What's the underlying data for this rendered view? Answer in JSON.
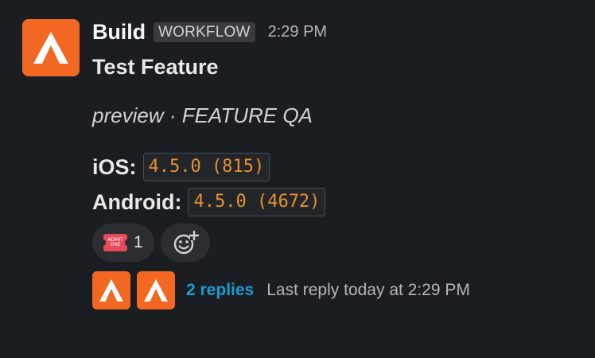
{
  "message": {
    "sender": "Build",
    "tag": "WORKFLOW",
    "time": "2:29 PM",
    "title": "Test Feature",
    "subtitle": "preview · FEATURE QA",
    "versions": [
      {
        "platform": "iOS:",
        "version": "4.5.0 (815)"
      },
      {
        "platform": "Android:",
        "version": "4.5.0 (4672)"
      }
    ],
    "reactions": [
      {
        "emoji": "admit-one-ticket",
        "ticket_text": "ADMIT ONE",
        "count": "1"
      }
    ],
    "add_reaction_icon": "add-emoji-icon",
    "thread": {
      "replies": "2 replies",
      "last_reply": "Last reply today at 2:29 PM"
    }
  },
  "colors": {
    "background": "#1a1d21",
    "avatar": "#f26722",
    "code": "#e8912d",
    "link": "#1d9bd1",
    "tag_bg": "#393b3f"
  }
}
